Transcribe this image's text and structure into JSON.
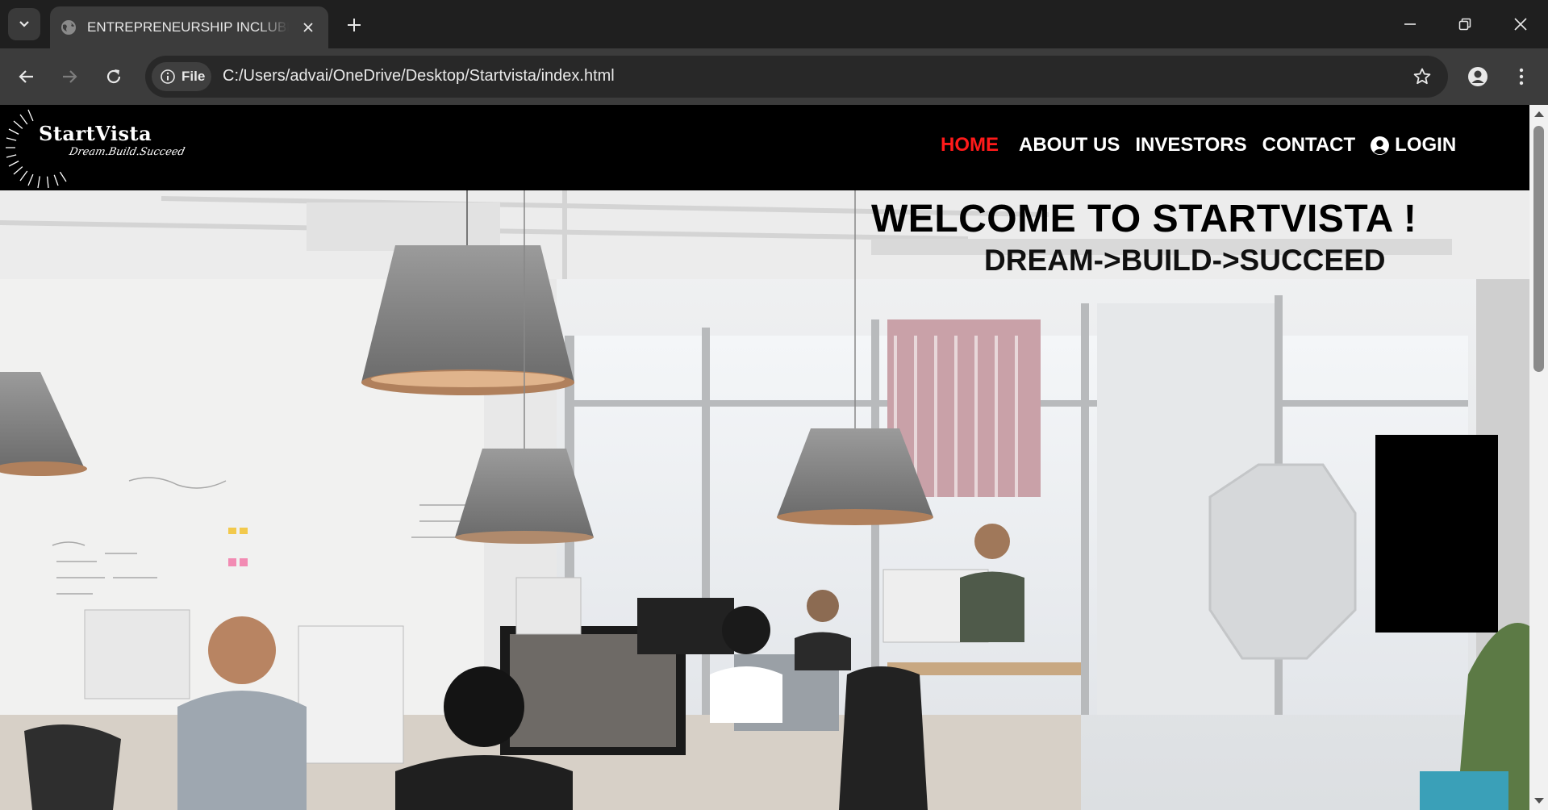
{
  "browser": {
    "tab_title": "ENTREPRENEURSHIP INCLUBLATOR",
    "site_chip": "File",
    "url": "C:/Users/advai/OneDrive/Desktop/Startvista/index.html"
  },
  "site": {
    "logo_title": "StartVista",
    "logo_tagline": "Dream.Build.Succeed",
    "nav": {
      "home": "HOME",
      "about": "ABOUT US",
      "investors": "INVESTORS",
      "contact": "CONTACT",
      "login": "LOGIN"
    },
    "active_color": "#ff1a1a"
  },
  "hero": {
    "title": "WELCOME TO STARTVISTA !",
    "subtitle": "DREAM->BUILD->SUCCEED"
  },
  "icons": [
    "tab-search-icon",
    "globe-icon",
    "close-icon",
    "plus-icon",
    "minimize-icon",
    "restore-icon",
    "back-icon",
    "forward-icon",
    "reload-icon",
    "info-icon",
    "star-icon",
    "profile-icon",
    "menu-icon",
    "user-circle-icon"
  ]
}
